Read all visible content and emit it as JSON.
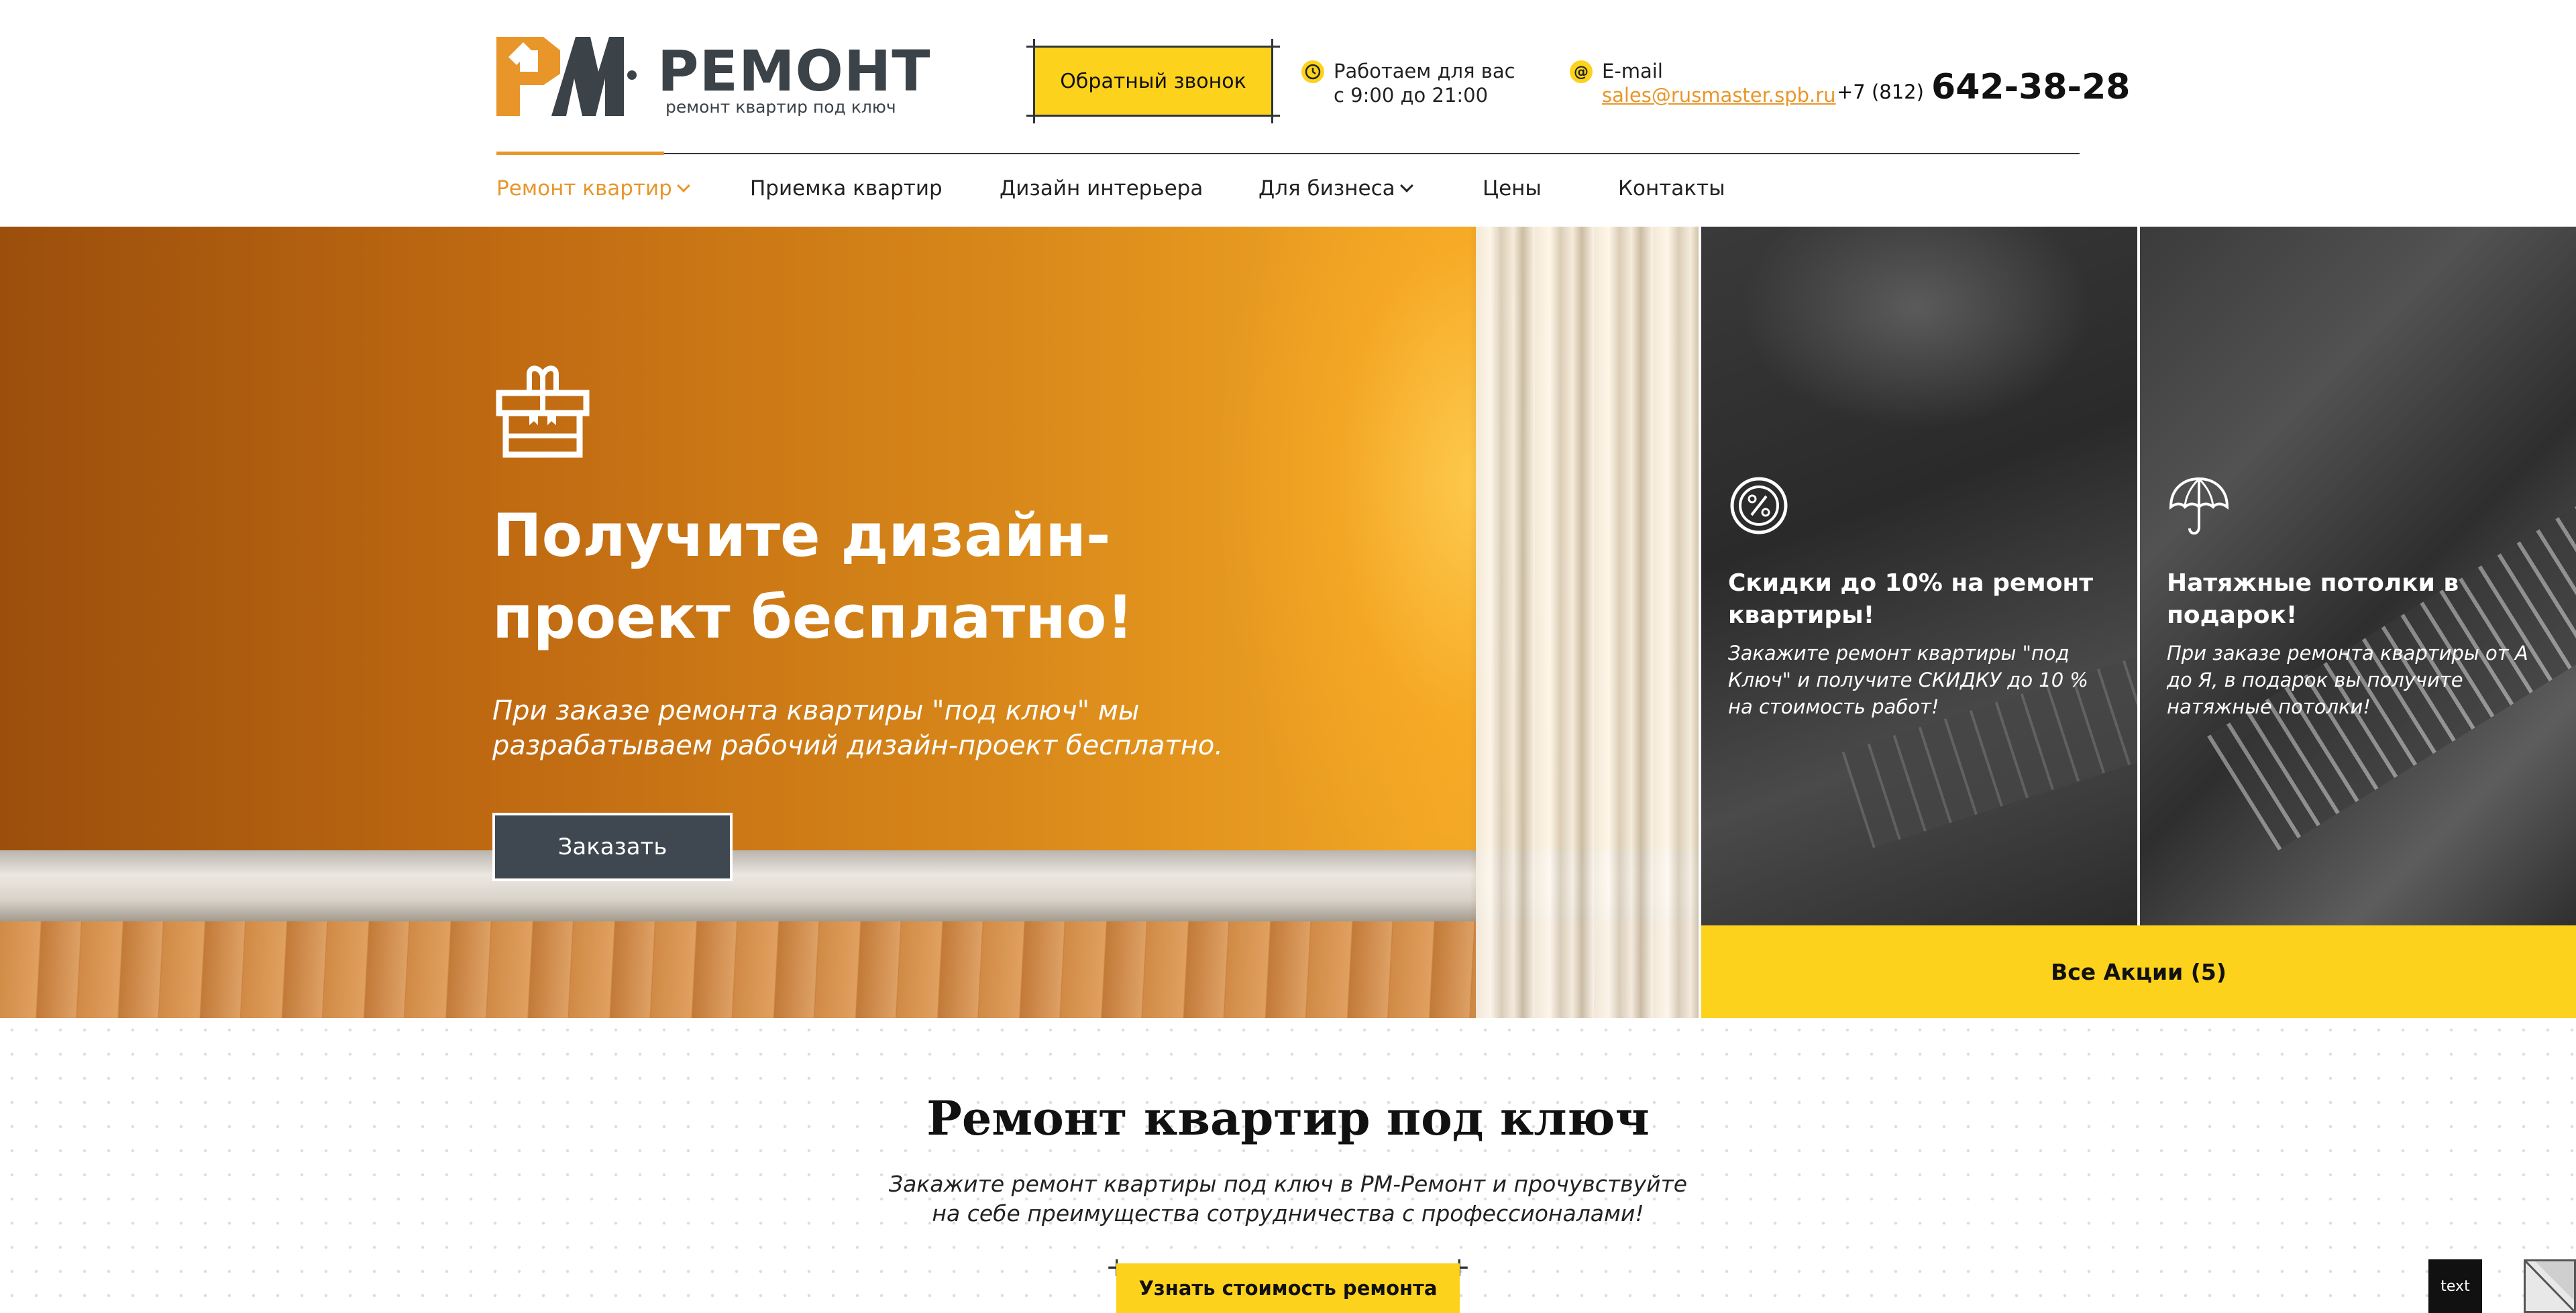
{
  "brand": {
    "name": "РЕМОНТ",
    "tagline": "ремонт квартир под ключ",
    "logo_letters": "PM",
    "accent_color": "#e8962a",
    "dark_color": "#3b4248"
  },
  "header": {
    "callback_label": "Обратный звонок",
    "hours_line1": "Работаем для вас",
    "hours_line2": "с 9:00 до 21:00",
    "email_label": "E-mail",
    "email_value": "sales@rusmaster.spb.ru",
    "phone_code": "+7 (812)",
    "phone_number": "642-38-28",
    "hours_icon": "clock-icon",
    "email_icon": "at-icon"
  },
  "nav": {
    "items": [
      {
        "label": "Ремонт квартир",
        "active": true,
        "has_dropdown": true
      },
      {
        "label": "Приемка квартир",
        "active": false,
        "has_dropdown": false
      },
      {
        "label": "Дизайн интерьера",
        "active": false,
        "has_dropdown": false
      },
      {
        "label": "Для бизнеса",
        "active": false,
        "has_dropdown": true
      },
      {
        "label": "Цены",
        "active": false,
        "has_dropdown": false
      },
      {
        "label": "Контакты",
        "active": false,
        "has_dropdown": false
      }
    ]
  },
  "hero": {
    "icon": "gift-icon",
    "title": "Получите дизайн-проект бесплатно!",
    "subtitle": "При заказе ремонта квартиры \"под ключ\" мы разрабатываем рабочий дизайн-проект бесплатно.",
    "button_label": "Заказать"
  },
  "promos": [
    {
      "icon": "percent-icon",
      "title": "Скидки до 10% на ремонт квартиры!",
      "text": "Закажите ремонт квартиры \"под Ключ\" и получите СКИДКУ до 10 % на стоимость работ!"
    },
    {
      "icon": "umbrella-icon",
      "title": "Натяжные потолки в подарок!",
      "text": "При заказе ремонта квартиры от А до Я, в подарок вы получите натяжные потолки!"
    }
  ],
  "all_promos_label": "Все Акции (5)",
  "section": {
    "title": "Ремонт квартир под ключ",
    "subtitle": "Закажите ремонт квартиры под ключ в РМ-Ремонт и прочувствуйте на себе преимущества сотрудничества с профессионалами!",
    "cost_button_label": "Узнать стоимость ремонта"
  },
  "widgets": {
    "text_label": "text"
  },
  "colors": {
    "yellow": "#fcd21c",
    "orange": "#e8962a",
    "dark_button": "#3f4850"
  }
}
